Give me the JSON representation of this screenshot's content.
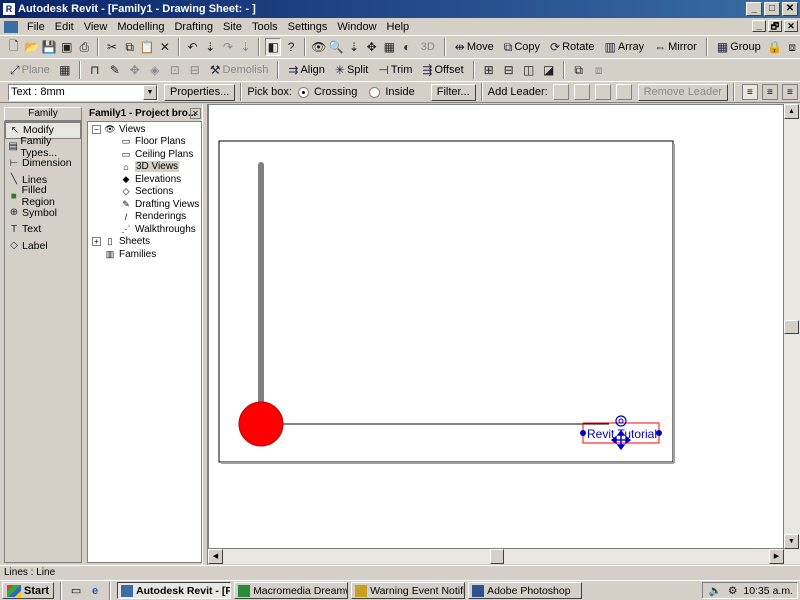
{
  "window": {
    "title": "Autodesk Revit - [Family1 - Drawing Sheet: - ]",
    "controls": [
      "_",
      "□",
      "✕"
    ],
    "doc_controls": [
      "_",
      "🗗",
      "✕"
    ]
  },
  "menu": [
    "File",
    "Edit",
    "View",
    "Modelling",
    "Drafting",
    "Site",
    "Tools",
    "Settings",
    "Window",
    "Help"
  ],
  "toolbar1": {
    "tools": [
      {
        "label": "Move",
        "icon": "move-icon"
      },
      {
        "label": "Copy",
        "icon": "copy-icon"
      },
      {
        "label": "Rotate",
        "icon": "rotate-icon"
      },
      {
        "label": "Array",
        "icon": "array-icon"
      },
      {
        "label": "Mirror",
        "icon": "mirror-icon"
      },
      {
        "label": "Group",
        "icon": "group-icon"
      }
    ],
    "threed_label": "3D"
  },
  "toolbar2": {
    "plane": "Plane",
    "demolish": "Demolish",
    "align": "Align",
    "split": "Split",
    "trim": "Trim",
    "offset": "Offset"
  },
  "options_bar": {
    "type_value": "Text : 8mm",
    "properties": "Properties...",
    "pick_box": "Pick box:",
    "crossing": "Crossing",
    "inside": "Inside",
    "filter": "Filter...",
    "add_leader": "Add Leader:",
    "remove_leader": "Remove Leader"
  },
  "family_panel": {
    "header": "Family",
    "items": [
      {
        "label": "Modify",
        "icon": "arrow-cursor-icon",
        "glyph": "↖",
        "active": true
      },
      {
        "label": "Family Types...",
        "icon": "family-types-icon",
        "glyph": "▤",
        "active": false
      },
      {
        "label": "Dimension",
        "icon": "dimension-icon",
        "glyph": "⊢",
        "active": false
      },
      {
        "label": "Lines",
        "icon": "lines-icon",
        "glyph": "╲",
        "active": false
      },
      {
        "label": "Filled Region",
        "icon": "filled-region-icon",
        "glyph": "■",
        "active": false
      },
      {
        "label": "Symbol",
        "icon": "symbol-icon",
        "glyph": "⊕",
        "active": false
      },
      {
        "label": "Text",
        "icon": "text-icon",
        "glyph": "T",
        "active": false
      },
      {
        "label": "Label",
        "icon": "label-icon",
        "glyph": "◇",
        "active": false
      }
    ]
  },
  "project_browser": {
    "header": "Family1 - Project bro...",
    "views_label": "Views",
    "views": [
      {
        "label": "Floor Plans",
        "icon": "floor-plan-icon",
        "glyph": "▭"
      },
      {
        "label": "Ceiling Plans",
        "icon": "ceiling-plan-icon",
        "glyph": "▭"
      },
      {
        "label": "3D Views",
        "icon": "3d-view-icon",
        "glyph": "⌂",
        "selected": true
      },
      {
        "label": "Elevations",
        "icon": "elevation-icon",
        "glyph": "◆"
      },
      {
        "label": "Sections",
        "icon": "section-icon",
        "glyph": "◇"
      },
      {
        "label": "Drafting Views",
        "icon": "drafting-view-icon",
        "glyph": "✎"
      },
      {
        "label": "Renderings",
        "icon": "rendering-icon",
        "glyph": "/"
      },
      {
        "label": "Walkthroughs",
        "icon": "walkthrough-icon",
        "glyph": "⋰"
      }
    ],
    "sheets_label": "Sheets",
    "families_label": "Families"
  },
  "drawing": {
    "text_element": "Revit Tutorial",
    "marker_color": "#ff0000",
    "selection_color": "#0000c0"
  },
  "status": "Lines : Line",
  "taskbar": {
    "start": "Start",
    "tasks": [
      {
        "label": "Autodesk Revit - [F...",
        "active": true
      },
      {
        "label": "Macromedia Dreamwe...",
        "active": false
      },
      {
        "label": "Warning Event Notific...",
        "active": false
      },
      {
        "label": "Adobe Photoshop",
        "active": false
      }
    ],
    "clock": "10:35 a.m."
  }
}
